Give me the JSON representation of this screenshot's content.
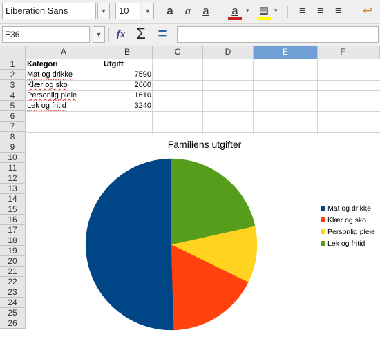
{
  "toolbar": {
    "font_name": "Liberation Sans",
    "font_size": "10",
    "icons": [
      "bold-shadow-icon",
      "italic-icon",
      "underline-icon",
      "font-color-icon",
      "highlight-icon",
      "align-left-icon",
      "align-center-icon",
      "align-right-icon",
      "wrap-text-icon"
    ]
  },
  "formula_bar": {
    "cell_ref": "E36",
    "formula_value": ""
  },
  "columns": [
    "A",
    "B",
    "C",
    "D",
    "E",
    "F"
  ],
  "selected_column": "E",
  "rows": [
    "1",
    "2",
    "3",
    "4",
    "5",
    "6",
    "7",
    "8",
    "9",
    "10",
    "11",
    "12",
    "13",
    "14",
    "15",
    "16",
    "17",
    "18",
    "19",
    "20",
    "21",
    "22",
    "23",
    "24",
    "25",
    "26"
  ],
  "table": {
    "headers": [
      "Kategori",
      "Utgift"
    ],
    "data": [
      {
        "kategori": "Mat og drikke",
        "utgift": "7590"
      },
      {
        "kategori": "Klær og sko",
        "utgift": "2600"
      },
      {
        "kategori": "Personlig pleie",
        "utgift": "1610"
      },
      {
        "kategori": "Lek og fritid",
        "utgift": "3240"
      }
    ]
  },
  "chart_data": {
    "type": "pie",
    "title": "Familiens utgifter",
    "categories": [
      "Mat og drikke",
      "Klær og sko",
      "Personlig pleie",
      "Lek og fritid"
    ],
    "values": [
      7590,
      2600,
      1610,
      3240
    ],
    "colors": [
      "#004586",
      "#ff420e",
      "#ffd320",
      "#579d1c"
    ],
    "legend_position": "right"
  }
}
